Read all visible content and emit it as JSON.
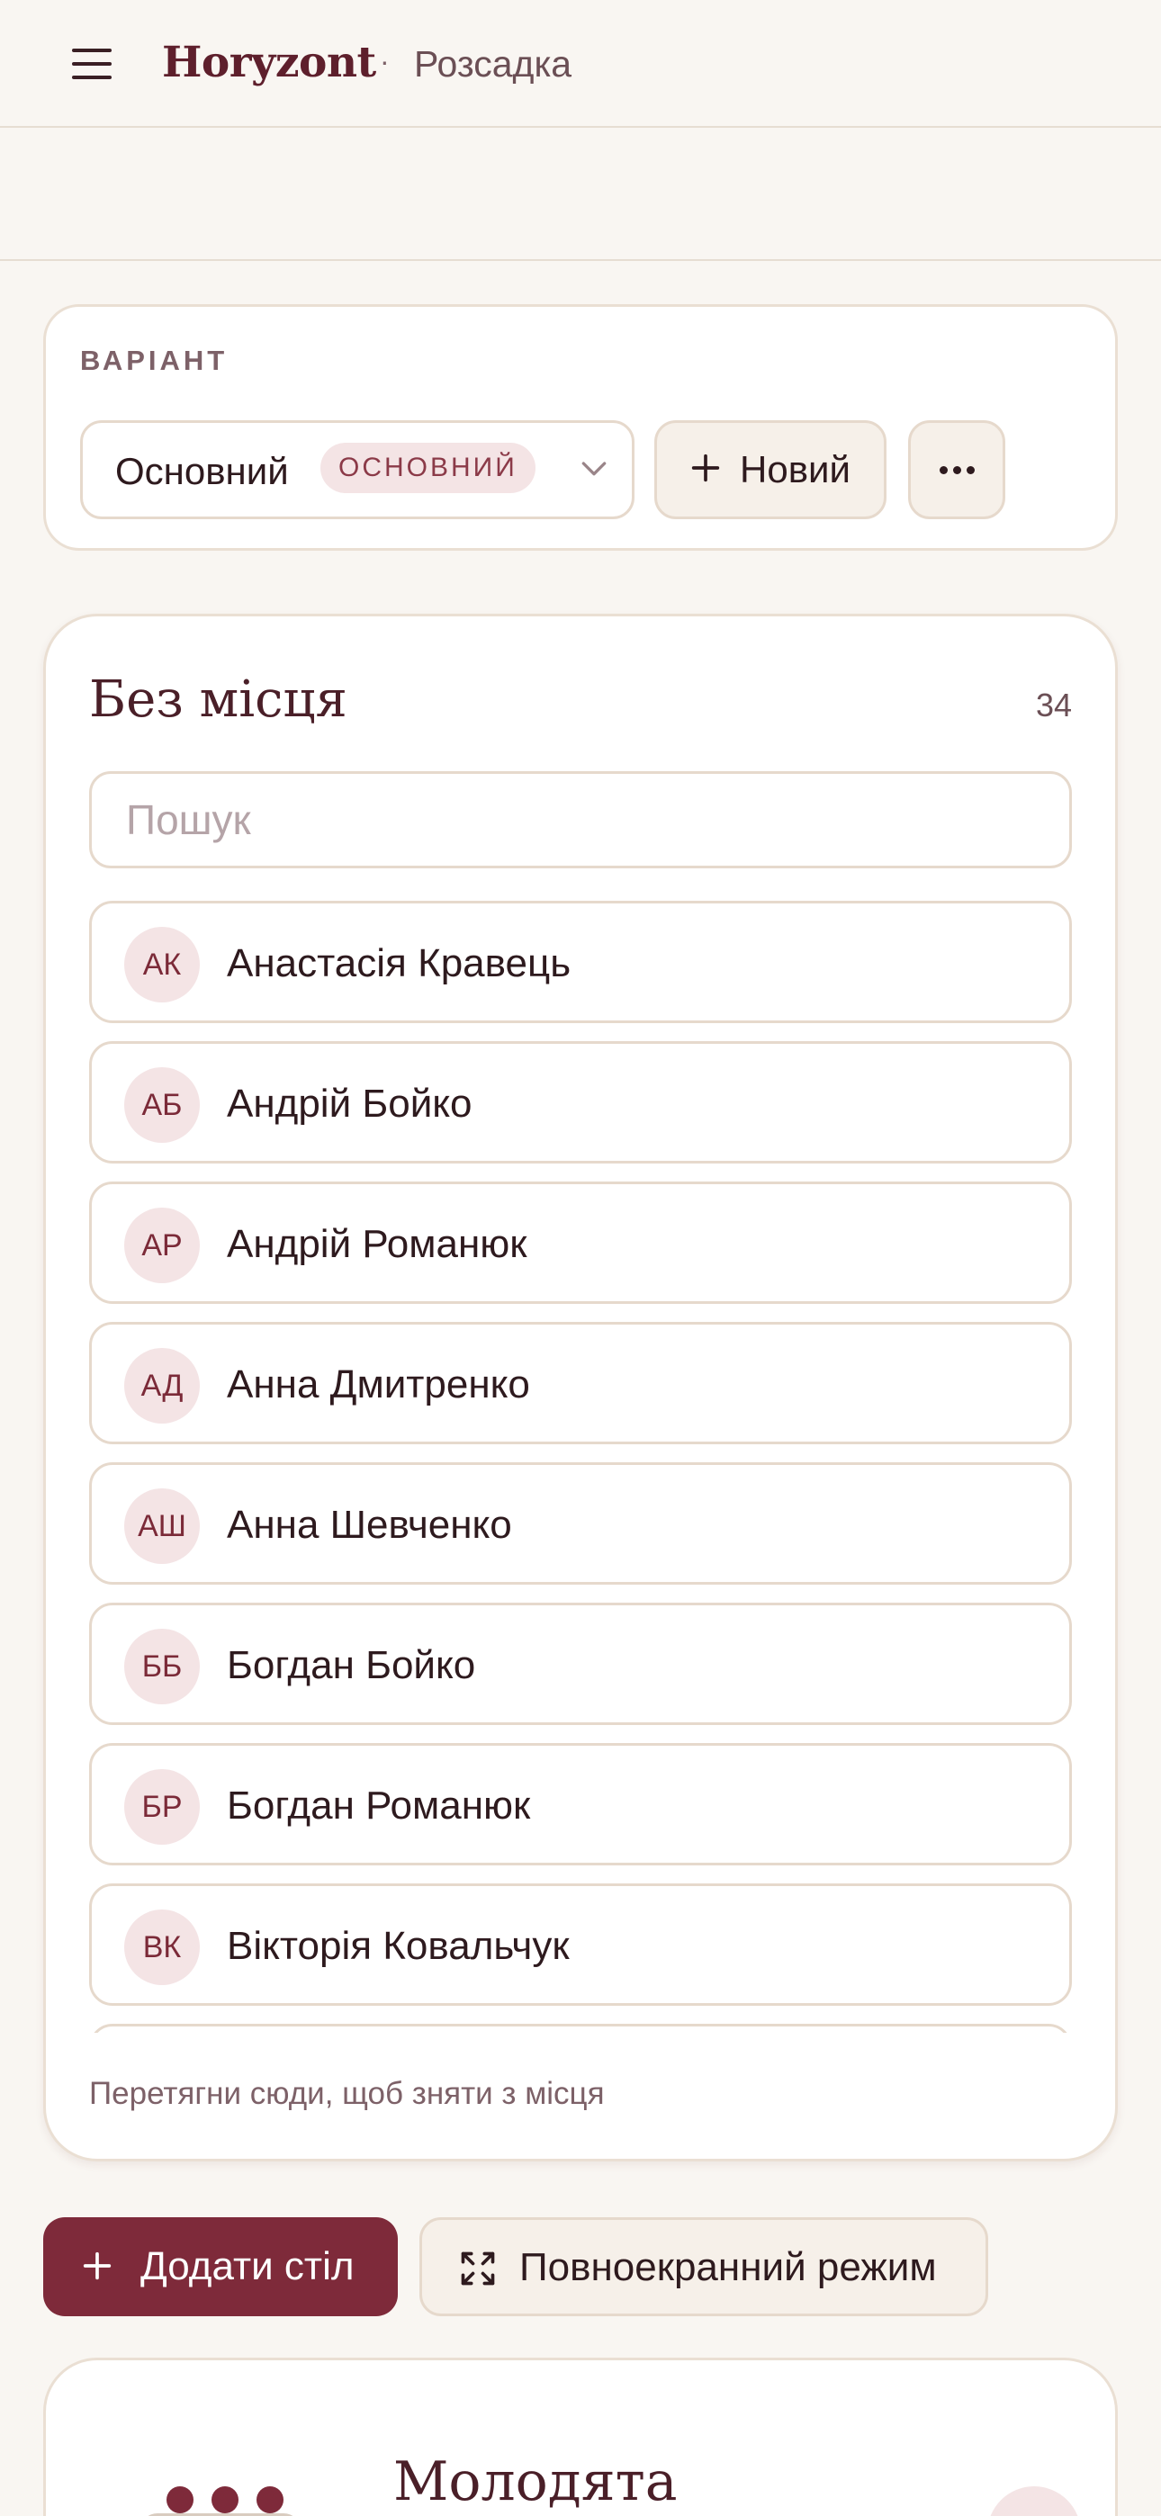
{
  "header": {
    "brand": "Horyzont",
    "separator": "·",
    "section": "Розсадка"
  },
  "variant": {
    "label": "ВАРІАНТ",
    "selected": "Основний",
    "selected_badge": "ОСНОВНИЙ",
    "new_button": "Новий"
  },
  "unassigned": {
    "title": "Без місця",
    "count": "34",
    "search_placeholder": "Пошук",
    "guests": [
      {
        "initials": "АК",
        "name": "Анастасія Кравець"
      },
      {
        "initials": "АБ",
        "name": "Андрій Бойко"
      },
      {
        "initials": "АР",
        "name": "Андрій Романюк"
      },
      {
        "initials": "АД",
        "name": "Анна Дмитренко"
      },
      {
        "initials": "АШ",
        "name": "Анна Шевченко"
      },
      {
        "initials": "ББ",
        "name": "Богдан Бойко"
      },
      {
        "initials": "БР",
        "name": "Богдан Романюк"
      },
      {
        "initials": "ВК",
        "name": "Вікторія Ковальчук"
      }
    ],
    "hint": "Перетягни сюди, щоб зняти з місця"
  },
  "actions": {
    "add_table": "Додати стіл",
    "fullscreen": "Повноекранний режим"
  },
  "table": {
    "name": "Молодята"
  },
  "colors": {
    "accent": "#7e2a3a",
    "background": "#f9f6f2",
    "avatar_bg": "#f4e4e5"
  }
}
